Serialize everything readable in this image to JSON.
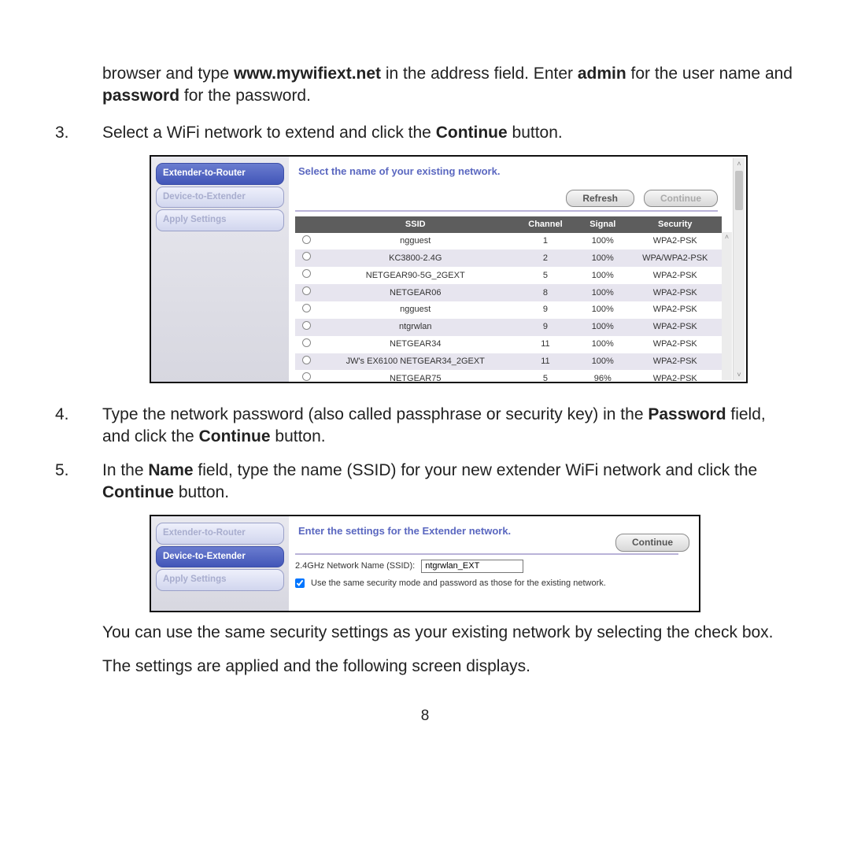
{
  "intro": {
    "pre": "browser and type ",
    "url": "www.mywifiext.net",
    "mid": " in the address field. Enter ",
    "user": "admin",
    "mid2": " for the user name and ",
    "pass": "password",
    "post": " for the password."
  },
  "steps": {
    "s3": {
      "num": "3.",
      "pre": "Select a WiFi network to extend and click the ",
      "btn": "Continue",
      "post": " button."
    },
    "s4": {
      "num": "4.",
      "pre": "Type the network password (also called passphrase or security key) in the ",
      "f1": "Password",
      "mid": " field, and click the ",
      "btn": "Continue",
      "post": " button."
    },
    "s5": {
      "num": "5.",
      "pre": "In the ",
      "f1": "Name",
      "mid": " field, type the name (SSID) for your new extender WiFi network and click the ",
      "btn": "Continue",
      "post": " button."
    }
  },
  "shot1": {
    "tabs": [
      "Extender-to-Router",
      "Device-to-Extender",
      "Apply Settings"
    ],
    "heading": "Select the name of your existing network.",
    "buttons": {
      "refresh": "Refresh",
      "cont": "Continue"
    },
    "cols": [
      "SSID",
      "Channel",
      "Signal",
      "Security"
    ],
    "rows": [
      {
        "ssid": "ngguest",
        "ch": "1",
        "sig": "100%",
        "sec": "WPA2-PSK"
      },
      {
        "ssid": "KC3800-2.4G",
        "ch": "2",
        "sig": "100%",
        "sec": "WPA/WPA2-PSK"
      },
      {
        "ssid": "NETGEAR90-5G_2GEXT",
        "ch": "5",
        "sig": "100%",
        "sec": "WPA2-PSK"
      },
      {
        "ssid": "NETGEAR06",
        "ch": "8",
        "sig": "100%",
        "sec": "WPA2-PSK"
      },
      {
        "ssid": "ngguest",
        "ch": "9",
        "sig": "100%",
        "sec": "WPA2-PSK"
      },
      {
        "ssid": "ntgrwlan",
        "ch": "9",
        "sig": "100%",
        "sec": "WPA2-PSK"
      },
      {
        "ssid": "NETGEAR34",
        "ch": "11",
        "sig": "100%",
        "sec": "WPA2-PSK"
      },
      {
        "ssid": "JW's EX6100 NETGEAR34_2GEXT",
        "ch": "11",
        "sig": "100%",
        "sec": "WPA2-PSK"
      },
      {
        "ssid": "NETGEAR75",
        "ch": "5",
        "sig": "96%",
        "sec": "WPA2-PSK"
      }
    ]
  },
  "shot2": {
    "tabs": [
      "Extender-to-Router",
      "Device-to-Extender",
      "Apply Settings"
    ],
    "heading": "Enter the settings for the Extender network.",
    "cont": "Continue",
    "label": "2.4GHz Network Name (SSID):",
    "value": "ntgrwlan_EXT",
    "checkbox": "Use the same security mode and password as those for the existing network."
  },
  "after1": "You can use the same security settings as your existing network by selecting the check box.",
  "after2": "The settings are applied and the following screen displays.",
  "page": "8"
}
